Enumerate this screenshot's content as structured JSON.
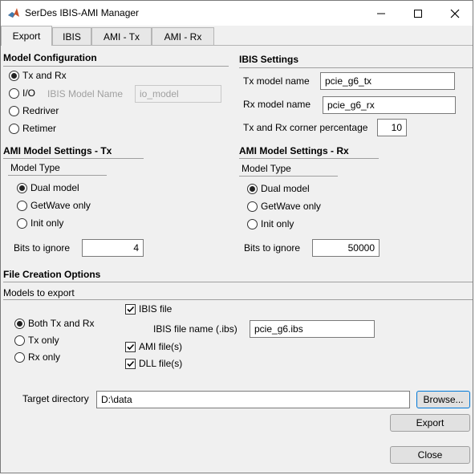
{
  "window": {
    "title": "SerDes IBIS-AMI Manager"
  },
  "tabs": [
    {
      "label": "Export"
    },
    {
      "label": "IBIS"
    },
    {
      "label": "AMI - Tx"
    },
    {
      "label": "AMI - Rx"
    }
  ],
  "model_config": {
    "title": "Model Configuration",
    "options": [
      "Tx and Rx",
      "I/O",
      "Redriver",
      "Retimer"
    ],
    "selected": "Tx and Rx",
    "ibis_model_name_label": "IBIS Model Name",
    "ibis_model_name_value": "io_model"
  },
  "ibis_settings": {
    "title": "IBIS Settings",
    "tx_label": "Tx model name",
    "tx_value": "pcie_g6_tx",
    "rx_label": "Rx model name",
    "rx_value": "pcie_g6_rx",
    "corner_label": "Tx and Rx corner percentage",
    "corner_value": "10"
  },
  "ami_tx": {
    "title": "AMI Model Settings - Tx",
    "model_type_label": "Model Type",
    "options": [
      "Dual model",
      "GetWave only",
      "Init only"
    ],
    "selected": "Dual model",
    "bits_label": "Bits to ignore",
    "bits_value": "4"
  },
  "ami_rx": {
    "title": "AMI Model Settings - Rx",
    "model_type_label": "Model Type",
    "options": [
      "Dual model",
      "GetWave only",
      "Init only"
    ],
    "selected": "Dual model",
    "bits_label": "Bits to ignore",
    "bits_value": "50000"
  },
  "file_creation": {
    "title": "File Creation Options",
    "models_label": "Models to export",
    "models": [
      "Both Tx and Rx",
      "Tx only",
      "Rx only"
    ],
    "models_selected": "Both Tx and Rx",
    "ibis_file_label": "IBIS file",
    "ibis_file_checked": true,
    "ibis_file_name_label": "IBIS file name (.ibs)",
    "ibis_file_name_value": "pcie_g6.ibs",
    "ami_files_label": "AMI file(s)",
    "ami_files_checked": true,
    "dll_files_label": "DLL file(s)",
    "dll_files_checked": true,
    "target_dir_label": "Target directory",
    "target_dir_value": "D:\\data",
    "browse_label": "Browse...",
    "export_label": "Export"
  },
  "close_label": "Close"
}
